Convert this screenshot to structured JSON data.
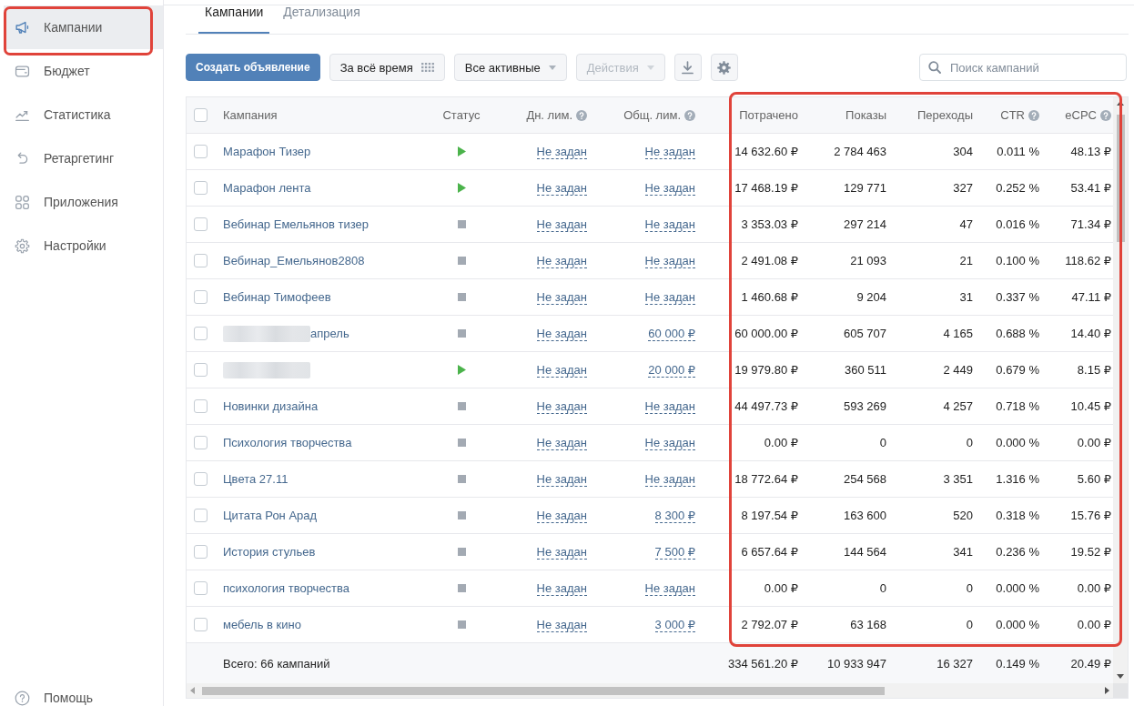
{
  "sidebar": {
    "items": [
      {
        "label": "Кампании",
        "selected": true,
        "highlighted": true
      },
      {
        "label": "Бюджет",
        "selected": false,
        "highlighted": false
      },
      {
        "label": "Статистика",
        "selected": false,
        "highlighted": false
      },
      {
        "label": "Ретаргетинг",
        "selected": false,
        "highlighted": false
      },
      {
        "label": "Приложения",
        "selected": false,
        "highlighted": false
      },
      {
        "label": "Настройки",
        "selected": false,
        "highlighted": false
      }
    ],
    "help": {
      "label": "Помощь"
    }
  },
  "tabs": [
    {
      "label": "Кампании",
      "selected": true
    },
    {
      "label": "Детализация",
      "selected": false
    }
  ],
  "toolbar": {
    "create_button": {
      "label": "Создать объявление"
    },
    "period": {
      "label": "За всё время"
    },
    "status_filter": {
      "label": "Все активные"
    },
    "actions": {
      "label": "Действия",
      "disabled": true
    },
    "search": {
      "placeholder": "Поиск кампаний"
    }
  },
  "table": {
    "header_checkbox": {
      "checked": false
    },
    "columns": [
      {
        "label": "Кампания",
        "help": false,
        "highlighted": false
      },
      {
        "label": "Статус",
        "help": false,
        "highlighted": false
      },
      {
        "label": "Дн. лим.",
        "help": true,
        "highlighted": false
      },
      {
        "label": "Общ. лим.",
        "help": true,
        "highlighted": false
      },
      {
        "label": "Потрачено",
        "help": false,
        "highlighted": true
      },
      {
        "label": "Показы",
        "help": false,
        "highlighted": true
      },
      {
        "label": "Переходы",
        "help": false,
        "highlighted": true
      },
      {
        "label": "CTR",
        "help": true,
        "highlighted": true
      },
      {
        "label": "eCPC",
        "help": true,
        "highlighted": true
      }
    ],
    "rows": [
      {
        "checked": false,
        "redacted": false,
        "name": "Марафон Тизер",
        "running": true,
        "day_limit": "Не задан",
        "total_limit": "Не задан",
        "spent": "14 632.60 ₽",
        "impressions": "2 784 463",
        "clicks": "304",
        "ctr": "0.011 %",
        "ecpc": "48.13 ₽"
      },
      {
        "checked": false,
        "redacted": false,
        "name": "Марафон лента",
        "running": true,
        "day_limit": "Не задан",
        "total_limit": "Не задан",
        "spent": "17 468.19 ₽",
        "impressions": "129 771",
        "clicks": "327",
        "ctr": "0.252 %",
        "ecpc": "53.41 ₽"
      },
      {
        "checked": false,
        "redacted": false,
        "name": "Вебинар Емельянов тизер",
        "running": false,
        "day_limit": "Не задан",
        "total_limit": "Не задан",
        "spent": "3 353.03 ₽",
        "impressions": "297 214",
        "clicks": "47",
        "ctr": "0.016 %",
        "ecpc": "71.34 ₽"
      },
      {
        "checked": false,
        "redacted": false,
        "name": "Вебинар_Емельянов2808",
        "running": false,
        "day_limit": "Не задан",
        "total_limit": "Не задан",
        "spent": "2 491.08 ₽",
        "impressions": "21 093",
        "clicks": "21",
        "ctr": "0.100 %",
        "ecpc": "118.62 ₽"
      },
      {
        "checked": false,
        "redacted": false,
        "name": "Вебинар Тимофеев",
        "running": false,
        "day_limit": "Не задан",
        "total_limit": "Не задан",
        "spent": "1 460.68 ₽",
        "impressions": "9 204",
        "clicks": "31",
        "ctr": "0.337 %",
        "ecpc": "47.11 ₽"
      },
      {
        "checked": false,
        "redacted": true,
        "name": "апрель",
        "running": false,
        "day_limit": "Не задан",
        "total_limit": "60 000 ₽",
        "spent": "60 000.00 ₽",
        "impressions": "605 707",
        "clicks": "4 165",
        "ctr": "0.688 %",
        "ecpc": "14.40 ₽"
      },
      {
        "checked": false,
        "redacted": true,
        "running": true,
        "day_limit": "Не задан",
        "total_limit": "20 000 ₽",
        "spent": "19 979.80 ₽",
        "impressions": "360 511",
        "clicks": "2 449",
        "ctr": "0.679 %",
        "ecpc": "8.15 ₽"
      },
      {
        "checked": false,
        "redacted": false,
        "name": "Новинки дизайна",
        "running": false,
        "day_limit": "Не задан",
        "total_limit": "Не задан",
        "spent": "44 497.73 ₽",
        "impressions": "593 269",
        "clicks": "4 257",
        "ctr": "0.718 %",
        "ecpc": "10.45 ₽"
      },
      {
        "checked": false,
        "redacted": false,
        "name": "Психология творчества",
        "running": false,
        "day_limit": "Не задан",
        "total_limit": "Не задан",
        "spent": "0.00 ₽",
        "impressions": "0",
        "clicks": "0",
        "ctr": "0.000 %",
        "ecpc": "0.00 ₽"
      },
      {
        "checked": false,
        "redacted": false,
        "name": "Цвета 27.11",
        "running": false,
        "day_limit": "Не задан",
        "total_limit": "Не задан",
        "spent": "18 772.64 ₽",
        "impressions": "254 568",
        "clicks": "3 351",
        "ctr": "1.316 %",
        "ecpc": "5.60 ₽"
      },
      {
        "checked": false,
        "redacted": false,
        "name": "Цитата Рон Арад",
        "running": false,
        "day_limit": "Не задан",
        "total_limit": "8 300 ₽",
        "spent": "8 197.54 ₽",
        "impressions": "163 600",
        "clicks": "520",
        "ctr": "0.318 %",
        "ecpc": "15.76 ₽"
      },
      {
        "checked": false,
        "redacted": false,
        "name": "История стульев",
        "running": false,
        "day_limit": "Не задан",
        "total_limit": "7 500 ₽",
        "spent": "6 657.64 ₽",
        "impressions": "144 564",
        "clicks": "341",
        "ctr": "0.236 %",
        "ecpc": "19.52 ₽"
      },
      {
        "checked": false,
        "redacted": false,
        "name": "психология творчества",
        "running": false,
        "day_limit": "Не задан",
        "total_limit": "Не задан",
        "spent": "0.00 ₽",
        "impressions": "0",
        "clicks": "0",
        "ctr": "0.000 %",
        "ecpc": "0.00 ₽"
      },
      {
        "checked": false,
        "redacted": false,
        "name": "мебель в кино",
        "running": false,
        "day_limit": "Не задан",
        "total_limit": "3 000 ₽",
        "spent": "2 792.07 ₽",
        "impressions": "63 168",
        "clicks": "0",
        "ctr": "0.000 %",
        "ecpc": "0.00 ₽"
      }
    ],
    "footer": {
      "label": "Всего: 66 кампаний",
      "spent": "334 561.20 ₽",
      "impressions": "10 933 947",
      "clicks": "16 327",
      "ctr": "0.149 %",
      "ecpc": "20.49 ₽"
    }
  }
}
